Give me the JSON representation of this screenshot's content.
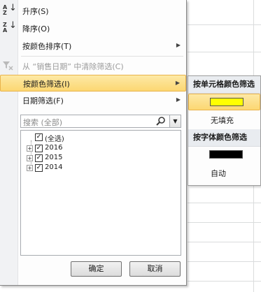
{
  "menu": {
    "sort_asc": "升序(S)",
    "sort_desc": "降序(O)",
    "sort_by_color": "按颜色排序(T)",
    "clear_filter": "从 “销售日期” 中清除筛选(C)",
    "filter_by_color": "按颜色筛选(I)",
    "date_filter": "日期筛选(F)"
  },
  "search": {
    "placeholder": "搜索 (全部)"
  },
  "tree": {
    "select_all": "(全选)",
    "years": [
      "2016",
      "2015",
      "2014"
    ]
  },
  "buttons": {
    "ok": "确定",
    "cancel": "取消"
  },
  "submenu": {
    "cell_color_header": "按单元格颜色筛选",
    "no_fill": "无填充",
    "font_color_header": "按字体颜色筛选",
    "auto": "自动",
    "cell_color_swatch": "#ffff00",
    "font_color_swatch": "#000000"
  },
  "icons": [
    "sort-asc-icon",
    "sort-desc-icon",
    "clear-filter-icon",
    "search-icon",
    "dropdown-arrow-icon",
    "expand-icon",
    "checkbox-icon"
  ]
}
